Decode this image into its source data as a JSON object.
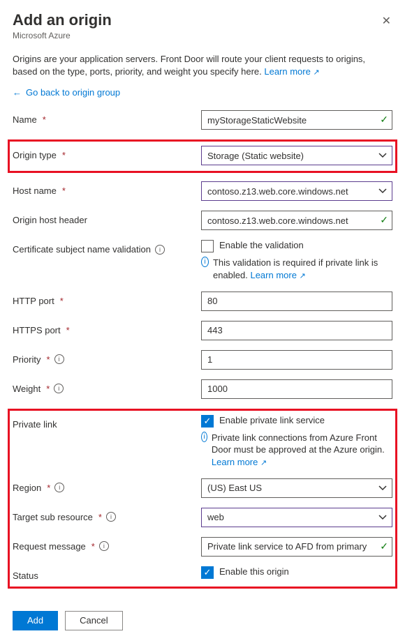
{
  "header": {
    "title": "Add an origin",
    "subtitle": "Microsoft Azure"
  },
  "intro": {
    "text": "Origins are your application servers. Front Door will route your client requests to origins, based on the type, ports, priority, and weight you specify here. ",
    "learnMore": "Learn more"
  },
  "backLink": "Go back to origin group",
  "fields": {
    "name": {
      "label": "Name",
      "value": "myStorageStaticWebsite"
    },
    "originType": {
      "label": "Origin type",
      "value": "Storage (Static website)"
    },
    "hostName": {
      "label": "Host name",
      "value": "contoso.z13.web.core.windows.net"
    },
    "originHostHeader": {
      "label": "Origin host header",
      "value": "contoso.z13.web.core.windows.net"
    },
    "certValidation": {
      "label": "Certificate subject name validation",
      "checkboxLabel": "Enable the validation",
      "helper": "This validation is required if private link is enabled. ",
      "learnMore": "Learn more"
    },
    "httpPort": {
      "label": "HTTP port",
      "value": "80"
    },
    "httpsPort": {
      "label": "HTTPS port",
      "value": "443"
    },
    "priority": {
      "label": "Priority",
      "value": "1"
    },
    "weight": {
      "label": "Weight",
      "value": "1000"
    },
    "privateLink": {
      "label": "Private link",
      "checkboxLabel": "Enable private link service",
      "helper": "Private link connections from Azure Front Door must be approved at the Azure origin. ",
      "learnMore": "Learn more"
    },
    "region": {
      "label": "Region",
      "value": "(US) East US"
    },
    "targetSubResource": {
      "label": "Target sub resource",
      "value": "web"
    },
    "requestMessage": {
      "label": "Request message",
      "value": "Private link service to AFD from primary"
    },
    "status": {
      "label": "Status",
      "checkboxLabel": "Enable this origin"
    }
  },
  "buttons": {
    "add": "Add",
    "cancel": "Cancel"
  }
}
